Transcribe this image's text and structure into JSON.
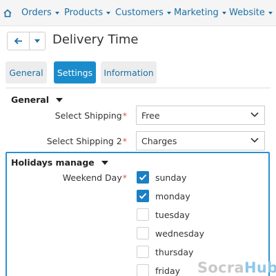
{
  "topnav": {
    "items": [
      {
        "label": "Orders"
      },
      {
        "label": "Products"
      },
      {
        "label": "Customers"
      },
      {
        "label": "Marketing"
      },
      {
        "label": "Website"
      }
    ]
  },
  "header": {
    "title": "Delivery Time"
  },
  "tabs": [
    {
      "label": "General",
      "active": false
    },
    {
      "label": "Settings",
      "active": true
    },
    {
      "label": "Information",
      "active": false
    }
  ],
  "general_section": {
    "title": "General",
    "fields": [
      {
        "label": "Select Shipping",
        "required_mark": "*",
        "value": "Free"
      },
      {
        "label": "Select Shipping 2",
        "required_mark": "*",
        "value": "Charges"
      }
    ]
  },
  "holidays_section": {
    "title": "Holidays manage",
    "field_label": "Weekend Day",
    "required_mark": "*",
    "days": [
      {
        "label": "sunday",
        "checked": true
      },
      {
        "label": "monday",
        "checked": true
      },
      {
        "label": "tuesday",
        "checked": false
      },
      {
        "label": "wednesday",
        "checked": false
      },
      {
        "label": "thursday",
        "checked": false
      },
      {
        "label": "friday",
        "checked": false
      }
    ]
  },
  "watermark": {
    "part1": "Socra",
    "part2": "Hub"
  },
  "colors": {
    "accent": "#1b8ccb",
    "link": "#1d6fa5",
    "focus_border": "#2a8fd0",
    "required": "#d9534f"
  }
}
